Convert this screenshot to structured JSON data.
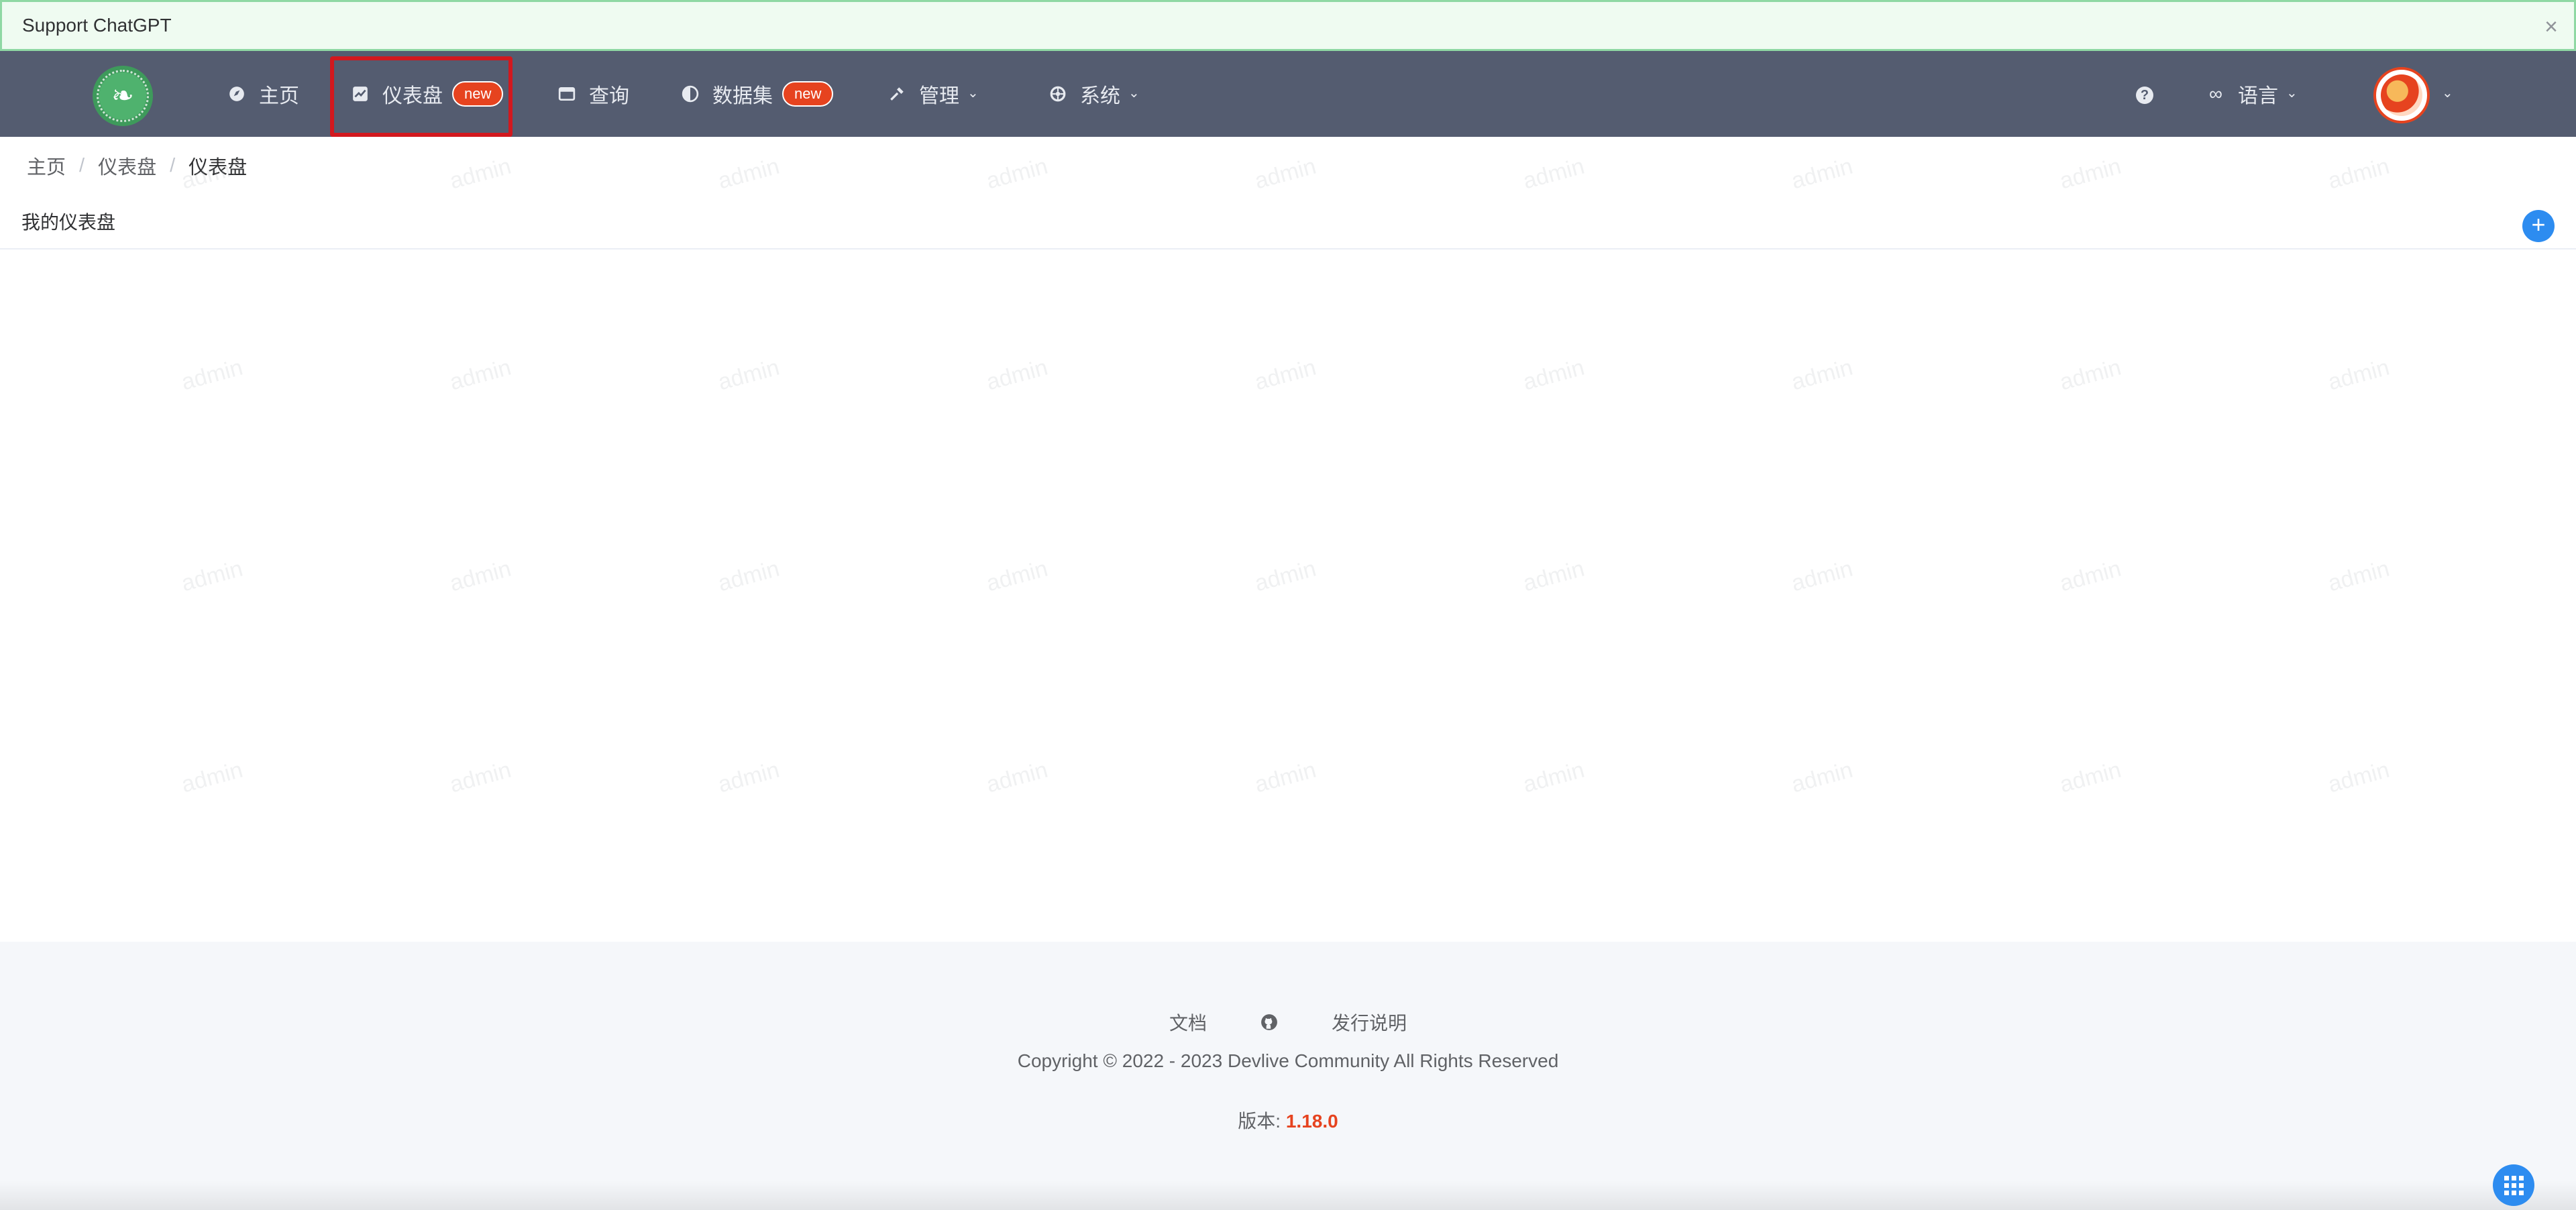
{
  "banner": {
    "text": "Support ChatGPT",
    "close_icon": "close-icon"
  },
  "nav": {
    "items": [
      {
        "label": "主页",
        "icon": "home-icon"
      },
      {
        "label": "仪表盘",
        "icon": "dashboard-icon",
        "badge": "new"
      },
      {
        "label": "查询",
        "icon": "query-icon"
      },
      {
        "label": "数据集",
        "icon": "dataset-icon",
        "badge": "new"
      },
      {
        "label": "管理",
        "icon": "wrench-icon"
      },
      {
        "label": "系统",
        "icon": "settings-icon"
      }
    ],
    "help_icon": "help-icon",
    "language": {
      "label": "语言",
      "icon": "language-icon"
    },
    "avatar_icon": "avatar"
  },
  "breadcrumb": [
    "主页",
    "仪表盘",
    "仪表盘"
  ],
  "main": {
    "section_title": "我的仪表盘",
    "add_icon": "plus-icon"
  },
  "watermark_text": "admin",
  "footer": {
    "docs_label": "文档",
    "github_icon": "github-icon",
    "release_label": "发行说明",
    "copyright": "Copyright © 2022 - 2023 Devlive Community All Rights Reserved",
    "version_label": "版本: ",
    "version_value": "1.18.0"
  },
  "colors": {
    "nav_bg": "#545c70",
    "accent": "#2d8cf0",
    "badge": "#e6431f",
    "highlight": "#d2181e"
  }
}
